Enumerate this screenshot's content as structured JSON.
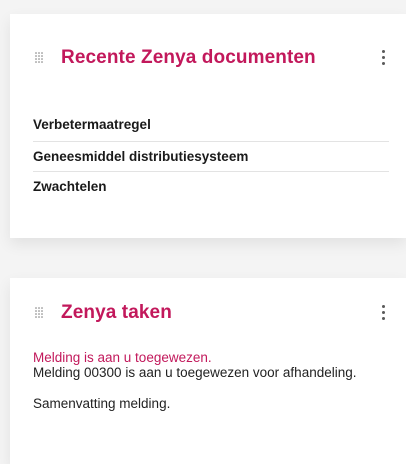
{
  "recent_documents": {
    "title": "Recente Zenya documenten",
    "items": [
      "Verbetermaatregel",
      "Geneesmiddel distributiesysteem",
      "Zwachtelen"
    ]
  },
  "tasks": {
    "title": "Zenya taken",
    "task": {
      "title": "Melding is aan u toegewezen.",
      "description": "Melding 00300 is aan u toegewezen voor afhandeling.",
      "summary": "Samenvatting melding."
    }
  },
  "colors": {
    "accent": "#c2185b",
    "background": "#f4f4f4",
    "card": "#ffffff"
  },
  "icons": {
    "drag": "drag-handle-icon",
    "more": "more-vertical-icon"
  }
}
